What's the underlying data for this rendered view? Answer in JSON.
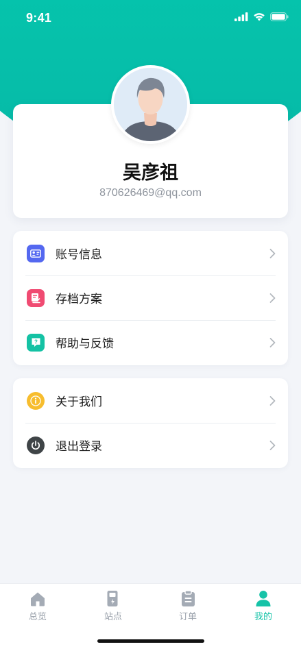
{
  "status_bar": {
    "time": "9:41"
  },
  "profile": {
    "name": "吴彦祖",
    "email": "870626469@qq.com"
  },
  "menu_group_1": [
    {
      "label": "账号信息",
      "icon": "id-card-icon",
      "color": "#5468f0"
    },
    {
      "label": "存档方案",
      "icon": "archive-doc-icon",
      "color": "#f04b72"
    },
    {
      "label": "帮助与反馈",
      "icon": "help-chat-icon",
      "color": "#14c2a4"
    }
  ],
  "menu_group_2": [
    {
      "label": "关于我们",
      "icon": "info-icon",
      "color": "#f7bd2e"
    },
    {
      "label": "退出登录",
      "icon": "power-icon",
      "color": "#3f4447"
    }
  ],
  "tab_bar": {
    "tabs": [
      {
        "label": "总览",
        "icon": "home-icon",
        "active": false
      },
      {
        "label": "站点",
        "icon": "station-icon",
        "active": false
      },
      {
        "label": "订单",
        "icon": "clipboard-icon",
        "active": false
      },
      {
        "label": "我的",
        "icon": "user-icon",
        "active": true
      }
    ]
  },
  "colors": {
    "brand": "#08cfa8",
    "tab_active": "#16c3a8",
    "tab_inactive": "#9aa1ab",
    "background": "#f3f5f9"
  }
}
